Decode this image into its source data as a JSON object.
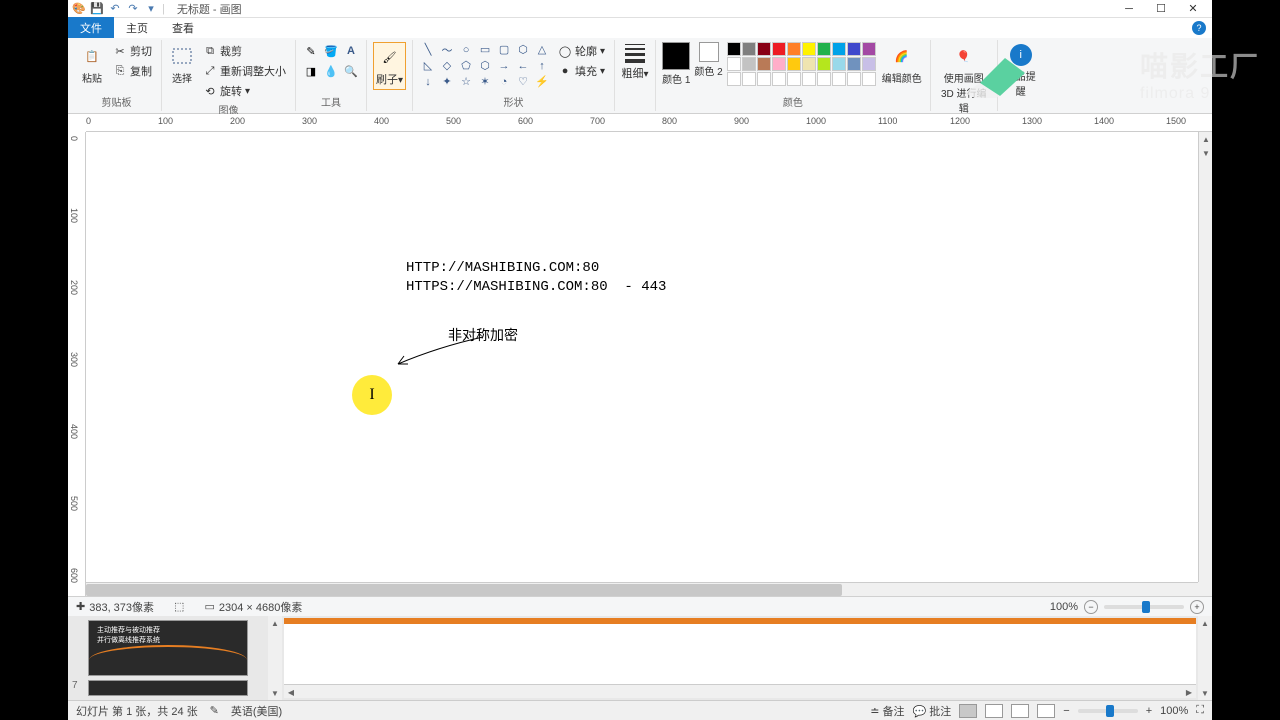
{
  "title_bar": {
    "app_title": "无标题 - 画图",
    "qat": {
      "save": "💾",
      "undo": "↶",
      "redo": "↷"
    }
  },
  "menu": {
    "file": "文件",
    "home": "主页",
    "view": "查看"
  },
  "ribbon": {
    "clipboard": {
      "label": "剪贴板",
      "paste": "粘贴",
      "cut": "剪切",
      "copy": "复制"
    },
    "image": {
      "label": "图像",
      "select": "选择",
      "crop": "裁剪",
      "resize": "重新调整大小",
      "rotate": "旋转"
    },
    "tools": {
      "label": "工具"
    },
    "brush": {
      "label": "刷子"
    },
    "shapes": {
      "label": "形状",
      "outline": "轮廓",
      "fill": "填充"
    },
    "stroke": {
      "label": "粗细"
    },
    "colors": {
      "label": "颜色",
      "color1": "颜色 1",
      "color2": "颜色 2",
      "edit": "编辑颜色"
    },
    "paint3d": {
      "label": "使用画图 3D 进行编辑"
    },
    "product": {
      "label": "产品提醒"
    }
  },
  "canvas": {
    "text_line1": "HTTP://MASHIBING.COM:80",
    "text_line2": "HTTPS://MASHIBING.COM:80  - 443",
    "text_line3": "非对称加密"
  },
  "ruler_marks_h": [
    "0",
    "100",
    "200",
    "300",
    "400",
    "500",
    "600",
    "700",
    "800",
    "900",
    "1000",
    "1100",
    "1200",
    "1300",
    "1400",
    "1500"
  ],
  "ruler_marks_v": [
    "0",
    "100",
    "200",
    "300",
    "400",
    "500",
    "600"
  ],
  "status": {
    "coords": "383, 373像素",
    "dimensions": "2304 × 4680像素",
    "zoom": "100%"
  },
  "ppt_status": {
    "slide_info": "幻灯片 第 1 张，共 24 张",
    "language": "英语(美国)",
    "notes": "备注",
    "comments": "批注",
    "zoom": "100%"
  },
  "palette_colors": [
    "#000000",
    "#7f7f7f",
    "#880015",
    "#ed1c24",
    "#ff7f27",
    "#fff200",
    "#22b14c",
    "#00a2e8",
    "#3f48cc",
    "#a349a4",
    "#ffffff",
    "#c3c3c3",
    "#b97a57",
    "#ffaec9",
    "#ffc90e",
    "#efe4b0",
    "#b5e61d",
    "#99d9ea",
    "#7092be",
    "#c8bfe7",
    "#ffffff",
    "#ffffff",
    "#ffffff",
    "#ffffff",
    "#ffffff",
    "#ffffff",
    "#ffffff",
    "#ffffff",
    "#ffffff",
    "#ffffff"
  ],
  "watermark": {
    "main": "喵影工厂",
    "sub": "filmora 9"
  }
}
